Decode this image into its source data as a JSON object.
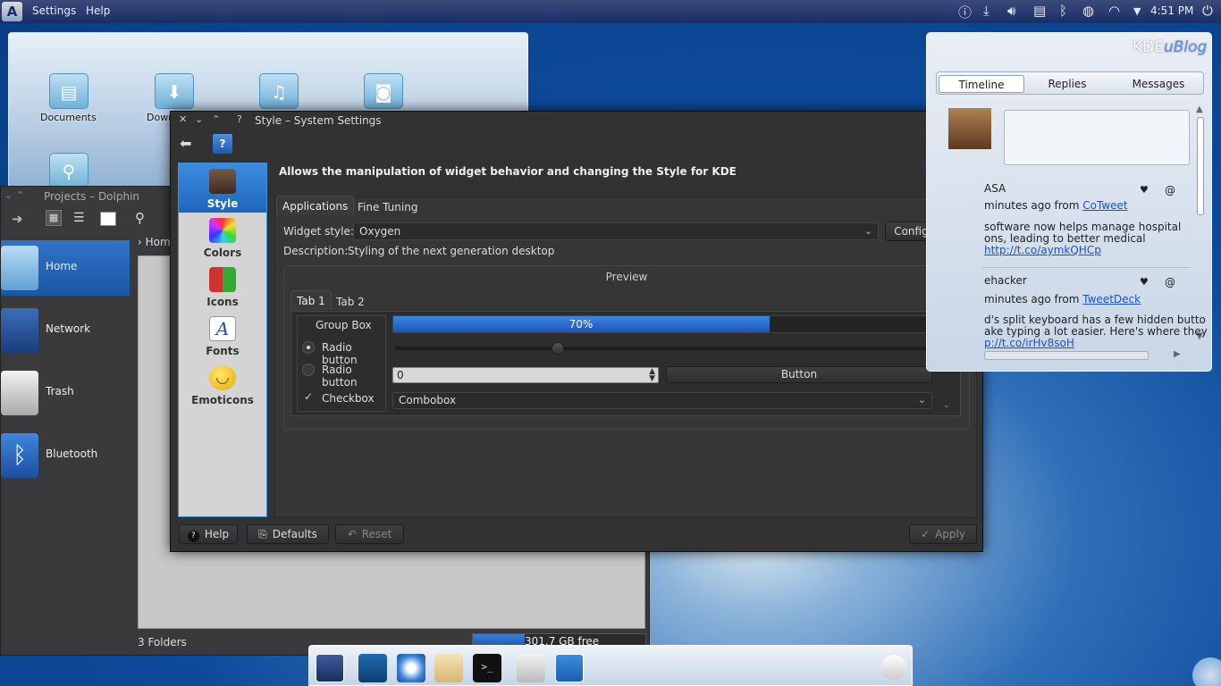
{
  "top_panel": {
    "menu": [
      "Settings",
      "Help"
    ],
    "clock": "4:51 PM"
  },
  "folder_view": {
    "icons": [
      {
        "label": "Documents",
        "icon": "document-icon"
      },
      {
        "label": "Down",
        "icon": "download-icon"
      },
      {
        "label": "",
        "icon": "music-icon"
      },
      {
        "label": "",
        "icon": "camera-icon"
      }
    ]
  },
  "dolphin": {
    "title": "Projects – Dolphin",
    "breadcrumb": "Hom",
    "places": [
      "Home",
      "Network",
      "Trash",
      "Bluetooth"
    ],
    "status": "3 Folders",
    "free_space": "301.7 GB free",
    "free_space_fraction": 0.3
  },
  "dialog": {
    "title": "Style – System Settings",
    "header": "Allows the manipulation of widget behavior and changing the Style for KDE",
    "categories": [
      "Style",
      "Colors",
      "Icons",
      "Fonts",
      "Emoticons"
    ],
    "tabs": [
      "Applications",
      "Fine Tuning"
    ],
    "widget_style_label": "Widget style:",
    "widget_style_value": "Oxygen",
    "configure_label": "Configure...",
    "description_label": "Description:",
    "description_value": "Styling of the next generation desktop",
    "preview": {
      "title": "Preview",
      "tabs": [
        "Tab 1",
        "Tab 2"
      ],
      "group_box": "Group Box",
      "radio1": "Radio button",
      "radio2": "Radio button",
      "checkbox": "Checkbox",
      "progress_text": "70%",
      "progress_value": 70,
      "spin_value": "0",
      "button": "Button",
      "combobox": "Combobox"
    },
    "buttons": {
      "help": "Help",
      "defaults": "Defaults",
      "reset": "Reset",
      "apply": "Apply"
    }
  },
  "microblog": {
    "brand": "KDE",
    "brand_tail": "uBlog",
    "tabs": [
      "Timeline",
      "Replies",
      "Messages"
    ],
    "posts": [
      {
        "user": "ASA",
        "time": "minutes ago from ",
        "client": "CoTweet",
        "line1": "software now helps manage hospital",
        "line2": "ons, leading to better medical",
        "link": "http://t.co/aymkQHCp"
      },
      {
        "user": "ehacker",
        "time": "minutes ago from ",
        "client": "TweetDeck",
        "line1": "d's split keyboard has a few hidden butto",
        "line2": "ake typing a lot easier. Here's where they",
        "link": "p://t.co/irHv8soH"
      }
    ]
  },
  "colors": {
    "accent": "#2a72d0",
    "dialog_bg": "#323233"
  }
}
